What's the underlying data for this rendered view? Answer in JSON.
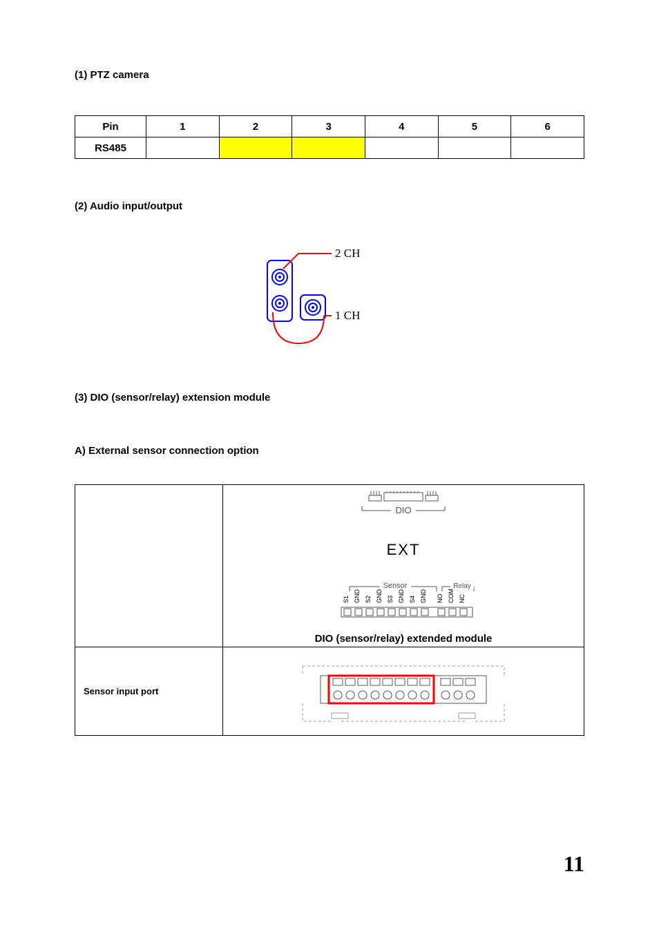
{
  "sections": {
    "s1_title": "(1) PTZ camera",
    "s2_title": "(2) Audio input/output",
    "s3_title": "(3) DIO (sensor/relay) extension module",
    "s3a_title": "A) External sensor connection option"
  },
  "pin_table": {
    "row1": [
      "Pin",
      "1",
      "2",
      "3",
      "4",
      "5",
      "6"
    ],
    "row2_first": "RS485"
  },
  "audio": {
    "ch2": "2 CH",
    "ch1": "1 CH"
  },
  "dio": {
    "module_caption": "DIO (sensor/relay) extended module",
    "sensor_row_label": "Sensor input port",
    "dio_text": "DIO",
    "ext_text": "EXT",
    "sensor_text": "Sensor",
    "relay_text": "Relay",
    "pins": [
      "S1",
      "GND",
      "S2",
      "GND",
      "S3",
      "GND",
      "S4",
      "GND",
      "NO",
      "COM",
      "NC"
    ]
  },
  "page_number": "11"
}
